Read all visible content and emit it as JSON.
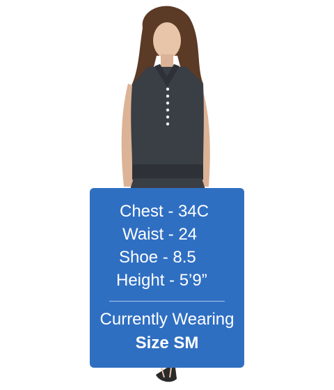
{
  "model_stats": {
    "chest": "Chest - 34C",
    "waist": "Waist - 24",
    "shoe": "Shoe - 8.5",
    "height": "Height - 5’9”"
  },
  "currently_wearing": {
    "label": "Currently Wearing",
    "size": "Size SM"
  },
  "colors": {
    "card_background": "#2f6fc2",
    "card_text": "#ffffff",
    "page_background": "#ffffff",
    "garment": "#3a3e45"
  }
}
